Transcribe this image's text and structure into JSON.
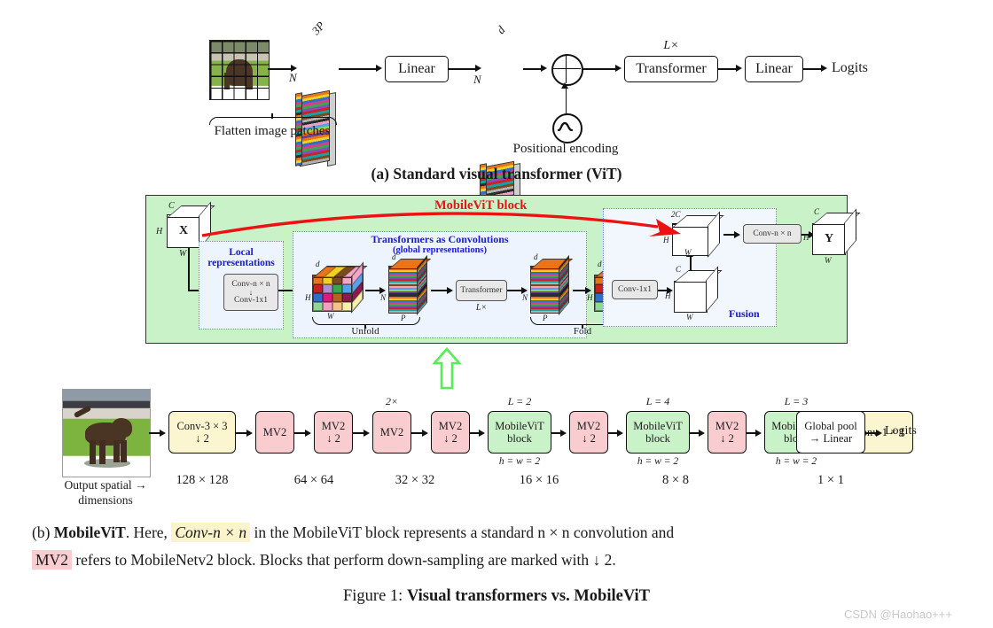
{
  "figure": {
    "title_prefix": "Figure 1: ",
    "title_bold": "Visual transformers vs. MobileViT",
    "watermark": "CSDN @Haohao+++"
  },
  "panel_a": {
    "caption": "(a) Standard visual transformer (ViT)",
    "image_label": "image-patches-grid",
    "brace_label": "Flatten image patches",
    "patch_slab_top_label": "3P",
    "patch_slab_side_label": "N",
    "embed_slab_top_label": "d",
    "embed_slab_side_label": "N",
    "linear1_label": "Linear",
    "add_symbol": "⊕",
    "pos_enc_label": "Positional encoding",
    "transformer_label": "Transformer",
    "transformer_repeat": "L×",
    "linear2_label": "Linear",
    "output_label": "Logits"
  },
  "panel_b_block": {
    "title": "MobileViT block",
    "input_cube": {
      "name": "X",
      "c": "C",
      "h": "H",
      "w": "W"
    },
    "output_cube": {
      "name": "Y",
      "c": "C",
      "h": "H",
      "w": "W"
    },
    "local": {
      "heading_line1": "Local",
      "heading_line2": "representations",
      "op_top": "Conv-n × n",
      "op_bottom": "Conv-1x1",
      "op_arrow": "↓"
    },
    "global": {
      "heading_line1": "Transformers as Convolutions",
      "heading_line2": "(global representations)",
      "cube_in": {
        "d": "d",
        "h": "H",
        "w": "W"
      },
      "seq_in": {
        "d": "d",
        "n": "N",
        "p": "P"
      },
      "transformer_label": "Transformer",
      "transformer_repeat": "L×",
      "seq_out": {
        "d": "d",
        "n": "N",
        "p": "P"
      },
      "cube_out": {
        "d": "d",
        "h": "H",
        "w": "W"
      },
      "brace_unfold": "Unfold",
      "brace_fold": "Fold"
    },
    "fusion": {
      "heading": "Fusion",
      "conv1x1_label": "Conv-1x1",
      "mid_cube": {
        "c": "C",
        "h": "H",
        "w": "W"
      },
      "concat_cube": {
        "c": "2C",
        "h": "H",
        "w": "W"
      },
      "convnn_label": "Conv-n × n"
    }
  },
  "panel_b_pipeline": {
    "input_caption_line1": "Output spatial →",
    "input_caption_line2": "dimensions",
    "blocks": [
      {
        "label_line1": "Conv-3 × 3",
        "label_line2": "↓ 2",
        "kind": "conv",
        "top": "",
        "bottom": ""
      },
      {
        "label_line1": "MV2",
        "label_line2": "",
        "kind": "mv2",
        "top": "",
        "bottom": ""
      },
      {
        "label_line1": "MV2",
        "label_line2": "↓ 2",
        "kind": "mv2",
        "top": "",
        "bottom": ""
      },
      {
        "label_line1": "MV2",
        "label_line2": "",
        "kind": "mv2",
        "top": "2×",
        "bottom": ""
      },
      {
        "label_line1": "MV2",
        "label_line2": "↓ 2",
        "kind": "mv2",
        "top": "",
        "bottom": ""
      },
      {
        "label_line1": "MobileViT",
        "label_line2": "block",
        "kind": "mvit",
        "top": "L = 2",
        "bottom": "h = w = 2"
      },
      {
        "label_line1": "MV2",
        "label_line2": "↓ 2",
        "kind": "mv2",
        "top": "",
        "bottom": ""
      },
      {
        "label_line1": "MobileViT",
        "label_line2": "block",
        "kind": "mvit",
        "top": "L = 4",
        "bottom": "h = w = 2"
      },
      {
        "label_line1": "MV2",
        "label_line2": "↓ 2",
        "kind": "mv2",
        "top": "",
        "bottom": ""
      },
      {
        "label_line1": "MobileViT",
        "label_line2": "block",
        "kind": "mvit",
        "top": "L = 3",
        "bottom": "h = w = 2"
      },
      {
        "label_line1": "Conv-1 × 1",
        "label_line2": "",
        "kind": "conv",
        "top": "",
        "bottom": ""
      },
      {
        "label_line1": "Global pool",
        "label_line2": "→ Linear",
        "kind": "plain",
        "top": "",
        "bottom": ""
      }
    ],
    "output_label": "Logits",
    "spatial_dims": [
      "128 × 128",
      "64 × 64",
      "32 × 32",
      "16 × 16",
      "8 × 8",
      "1 × 1"
    ]
  },
  "caption": {
    "seg1": "(b) ",
    "seg2_bold": "MobileViT",
    "seg3": ". Here, ",
    "seg4_hl": "Conv-n × n",
    "seg5": " in the MobileViT block represents a standard n × n convolution and",
    "seg6_hl": "MV2",
    "seg7": " refers to MobileNetv2 block. Blocks that perform down-sampling are marked with ↓ 2."
  },
  "colors": {
    "mobilevit_green": "#c9f2c9",
    "dashed_blue": "#6688cc",
    "heading_blue": "#1a1ad0",
    "title_red": "#e61414",
    "conv_yellow": "#fbf5d0",
    "mv2_pink": "#f9ccd0",
    "green_arrow": "#55ee55"
  }
}
